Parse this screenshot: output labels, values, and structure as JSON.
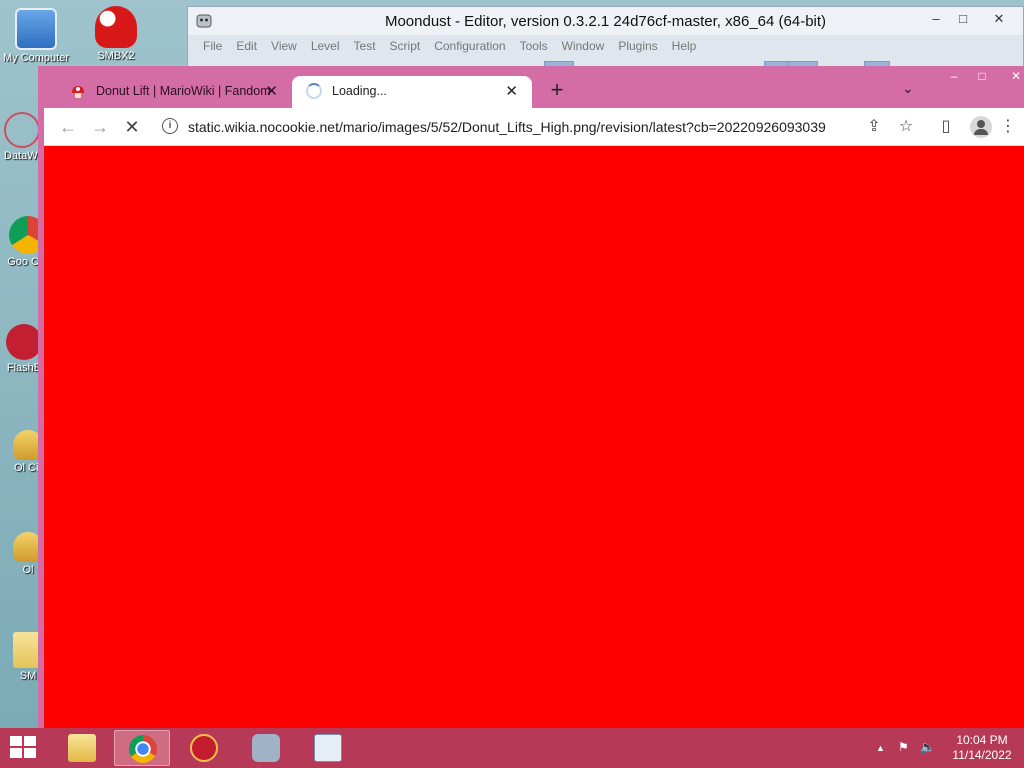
{
  "desktop": {
    "icons": [
      {
        "label": "My Computer"
      },
      {
        "label": "SMBX2"
      },
      {
        "label": "DataWi"
      },
      {
        "label": "Goo Chr"
      },
      {
        "label": "FlashB"
      },
      {
        "label": "Ol Cir"
      },
      {
        "label": "Ol"
      },
      {
        "label": "SM"
      }
    ]
  },
  "moondust": {
    "title": "Moondust - Editor, version 0.3.2.1 24d76cf-master, x86_64 (64-bit)",
    "menu": [
      "File",
      "Edit",
      "View",
      "Level",
      "Test",
      "Script",
      "Configuration",
      "Tools",
      "Window",
      "Plugins",
      "Help"
    ],
    "controls": {
      "minimize": "–",
      "maximize": "□",
      "close": "✕"
    }
  },
  "browser": {
    "tabs": [
      {
        "label": "Donut Lift | MarioWiki | Fandom",
        "close": "✕"
      },
      {
        "label": "Loading...",
        "close": "✕"
      }
    ],
    "new_tab": "+",
    "tab_search": "⌄",
    "controls": {
      "minimize": "–",
      "maximize": "□",
      "close": "✕"
    },
    "nav": {
      "back": "←",
      "forward": "→",
      "stop": "✕"
    },
    "address": {
      "info": "i",
      "url": "static.wikia.nocookie.net/mario/images/5/52/Donut_Lifts_High.png/revision/latest?cb=20220926093039"
    },
    "toolbar": {
      "share": "⇪",
      "star": "☆",
      "sidepanel": "▯",
      "menu": "⋮"
    },
    "page_background": "#ff0000"
  },
  "taskbar": {
    "tray_arrow": "▲",
    "tray_network": "⚑",
    "tray_volume": "🔈",
    "time": "10:04 PM",
    "date": "11/14/2022"
  }
}
